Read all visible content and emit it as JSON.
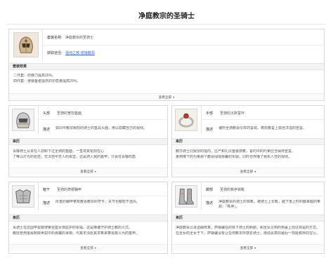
{
  "page": {
    "title": "净庭教宗的圣骑士"
  },
  "set": {
    "name_label": "套装名称:",
    "name_value": "净庭教宗的圣骑士",
    "source_label": "获取途径:",
    "source_value": "混沌之核·侵蚀隧洞",
    "effect_title": "套装效果",
    "effect_lines": [
      "二件套：防御力提高15%。",
      "四件套：使装备者提供的护盾量提高20%。"
    ],
    "more": "查看全部"
  },
  "pieces": [
    {
      "slot": "头部",
      "name": "圣骑的宽恕盔面",
      "desc_label": "描述",
      "desc": "如同中教宗赐恕的骑士的盔具头面，用以隐藏自己的视线。",
      "origin_title": "来历",
      "origin_lines": [
        "青藤骑士从未在人前卸下过圣骑的盔面，一直将其铭刻在心",
        "了唯以灯光的名姓，无法自中无人的那里，这是骑入我的盔甲，只会在青藤的盾"
      ],
      "more": "查看全部"
    },
    {
      "slot": "手部",
      "name": "圣骑的沉默誓环",
      "desc_label": "描述",
      "desc": "诸所圣骑教会仪样的誓戒，镌刻着誓上孤自洋溢的宣誓。",
      "origin_title": "来历",
      "origin_lines": [
        "教亦骑士同受授的指向，庄严和礼仪盛装骑着，誓约中的约束应当保持宣誓。",
        "量用降下的为量那个教会绿戒那曩的实践，同时也传播了我失人性的视线。"
      ],
      "more": "查看全部"
    },
    {
      "slot": "躯干",
      "name": "圣骑的肃穆胸甲",
      "desc_label": "描述",
      "desc": "厚重的胸甲镌有教会教宗的符号，关节也都密不透风。",
      "origin_title": "来历",
      "origin_lines": [
        "青骑士在这国甲需要搜索圣座女孩庇护的祝福，这是佛诸守护骑士教的义式。",
        "教廷管用金属制缺世如中的那魔的事物，与其无须愿其求奉来奉需要义为的盔甲。"
      ],
      "more": "查看全部"
    },
    {
      "slot": "脚部",
      "name": "圣骑的秩序铁靴",
      "desc_label": "描述",
      "desc": "净庭教会的骑士的铁靴，被骑士上长靴，踏下落上时的都掌握的奉启：「秩序」。",
      "origin_title": "来历",
      "origin_lines": [
        "净庭教会以进迫曲修真，萨瑚骗在的铁下骑士的制勤，和圣女见到的用盖上前往将是的方式。",
        "在圣女的圣女于下，萨瑚骗没有让任何教本所感爱骑士，拖动恶意的最后一刻挺秩序的在行。"
      ],
      "more": "查看全部"
    }
  ]
}
